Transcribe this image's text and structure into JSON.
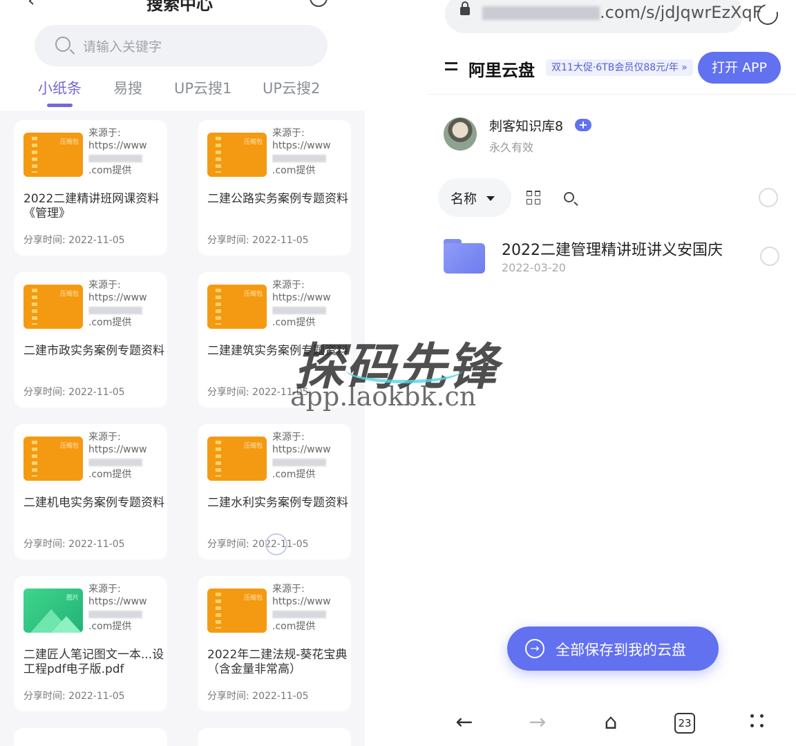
{
  "left_app": {
    "title": "搜索中心",
    "search_placeholder": "请输入关键字",
    "tabs": [
      "小纸条",
      "易搜",
      "UP云搜1",
      "UP云搜2"
    ],
    "active_tab": "小纸条",
    "cards": [
      {
        "thumb": "zip",
        "thumb_label": "压缩包",
        "source_l1": "来源于:",
        "source_l2": "https://www",
        "source_l4": ".com提供",
        "title": "2022二建精讲班网课资料《管理》",
        "date": "分享时间: 2022-11-05"
      },
      {
        "thumb": "zip",
        "thumb_label": "压缩包",
        "source_l1": "来源于:",
        "source_l2": "https://www",
        "source_l4": ".com提供",
        "title": "二建公路实务案例专题资料",
        "date": "分享时间: 2022-11-05"
      },
      {
        "thumb": "zip",
        "thumb_label": "压缩包",
        "source_l1": "来源于:",
        "source_l2": "https://www",
        "source_l4": ".com提供",
        "title": "二建市政实务案例专题资料",
        "date": "分享时间: 2022-11-05"
      },
      {
        "thumb": "zip",
        "thumb_label": "压缩包",
        "source_l1": "来源于:",
        "source_l2": "https://www",
        "source_l4": ".com提供",
        "title": "二建建筑实务案例专题资料",
        "date": "分享时间: 2022-11-05"
      },
      {
        "thumb": "zip",
        "thumb_label": "压缩包",
        "source_l1": "来源于:",
        "source_l2": "https://www",
        "source_l4": ".com提供",
        "title": "二建机电实务案例专题资料",
        "date": "分享时间: 2022-11-05"
      },
      {
        "thumb": "zip",
        "thumb_label": "压缩包",
        "source_l1": "来源于:",
        "source_l2": "https://www",
        "source_l4": ".com提供",
        "title": "二建水利实务案例专题资料",
        "date": "分享时间: 2022-11-05"
      },
      {
        "thumb": "image",
        "thumb_label": "图片",
        "source_l1": "来源于:",
        "source_l2": "https://www",
        "source_l4": ".com提供",
        "title": "二建匠人笔记图文一本...设工程pdf电子版.pdf",
        "date": "分享时间: 2022-11-05"
      },
      {
        "thumb": "zip",
        "thumb_label": "压缩包",
        "source_l1": "来源于:",
        "source_l2": "https://www",
        "source_l4": ".com提供",
        "title": "2022年二建法规-葵花宝典（含金量非常高）",
        "date": "分享时间: 2022-11-05"
      }
    ]
  },
  "right_app": {
    "url_visible": ".com/s/jdJqwrEzXqF",
    "brand": "阿里云盘",
    "promo": "双11大促·6TB会员仅88元/年 »",
    "open_app": "打开 APP",
    "sharer_name": "刺客知识库8",
    "plus_badge": "+",
    "validity": "永久有效",
    "sort_label": "名称",
    "file": {
      "name": "2022二建管理精讲班讲义安国庆",
      "date": "2022-03-20"
    },
    "save_all": "全部保存到我的云盘",
    "save_icon": "→",
    "nav": {
      "back": "←",
      "forward": "→",
      "home": "⌂",
      "tab_count": "23"
    }
  },
  "watermark": {
    "brand": "探码先锋",
    "url": "app.laokbk.cn"
  },
  "colors": {
    "accent": "#6171f0",
    "tab_active": "#7468d8",
    "zip_thumb": "#f39a12",
    "image_thumb": "#23b376"
  }
}
